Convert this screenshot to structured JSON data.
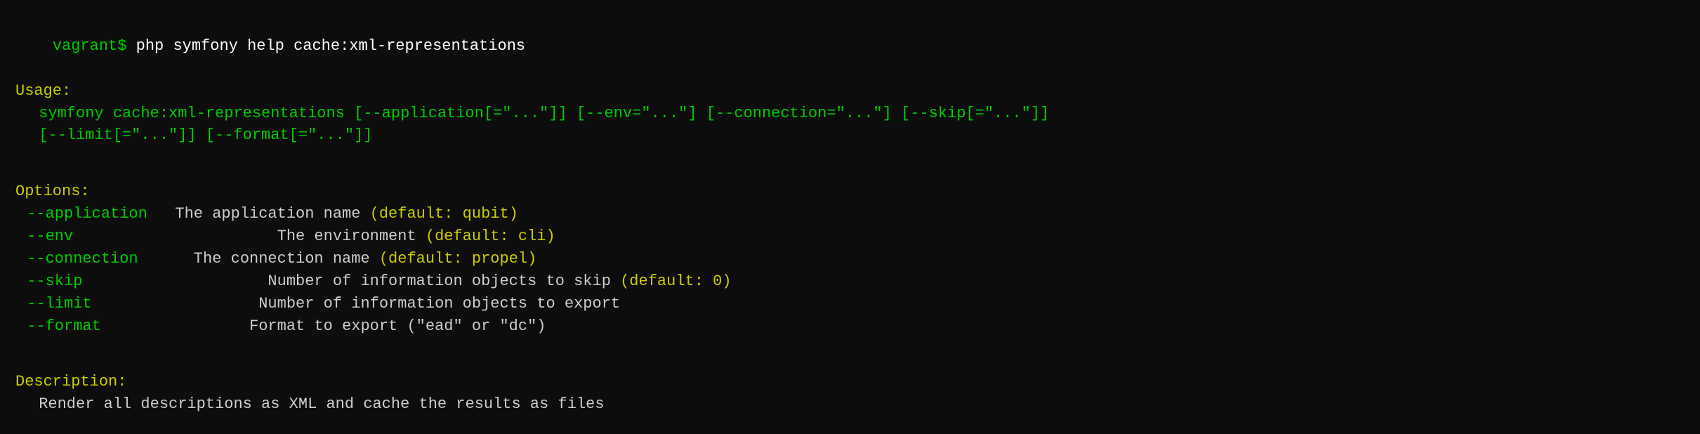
{
  "terminal": {
    "prompt": "vagrant$",
    "command": " php symfony help cache:xml-representations",
    "usage_label": "Usage:",
    "usage_line1": " symfony cache:xml-representations [--application[=\"...\"]] [--env=\"...\"] [--connection=\"...\"] [--skip[=\"...\"]]",
    "usage_line2": " [--limit[=\"...\"]] [--format[=\"...\"]]",
    "options_label": "Options:",
    "options": [
      {
        "flag": " --application",
        "desc": "  The application name ",
        "default": "(default: qubit)"
      },
      {
        "flag": " --env",
        "desc": "             The environment ",
        "default": "(default: cli)"
      },
      {
        "flag": " --connection",
        "desc": "    The connection name ",
        "default": "(default: propel)"
      },
      {
        "flag": " --skip",
        "desc": "            Number of information objects to skip ",
        "default": "(default: 0)"
      },
      {
        "flag": " --limit",
        "desc": "           Number of information objects to export",
        "default": ""
      },
      {
        "flag": " --format",
        "desc": "          Format to export (\"ead\" or \"dc\")",
        "default": ""
      }
    ],
    "description_label": "Description:",
    "description_text": " Render all descriptions as XML and cache the results as files"
  }
}
